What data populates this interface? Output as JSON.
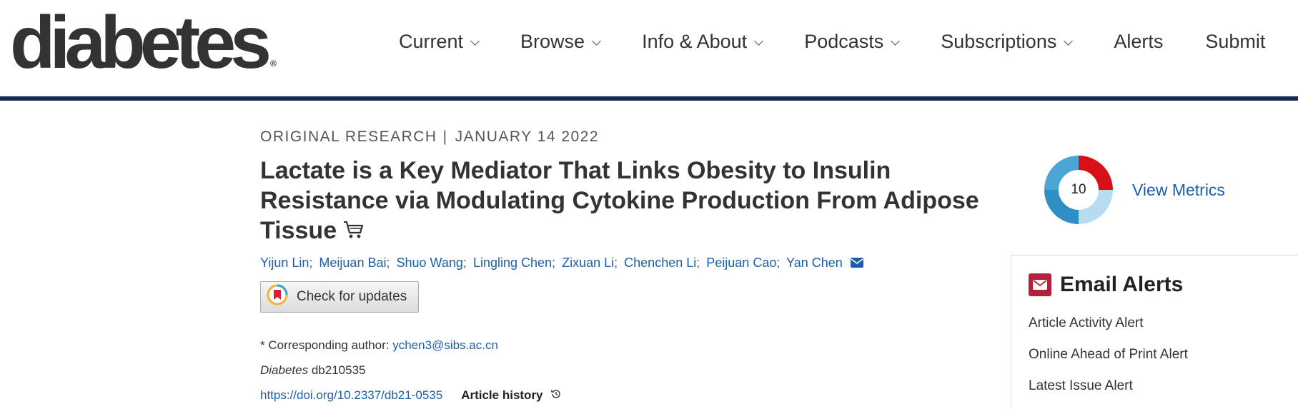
{
  "header": {
    "logo_text": "diabetes",
    "logo_mark": "®",
    "nav": [
      {
        "label": "Current",
        "dropdown": true
      },
      {
        "label": "Browse",
        "dropdown": true
      },
      {
        "label": "Info & About",
        "dropdown": true
      },
      {
        "label": "Podcasts",
        "dropdown": true
      },
      {
        "label": "Subscriptions",
        "dropdown": true
      },
      {
        "label": "Alerts",
        "dropdown": false
      },
      {
        "label": "Submit",
        "dropdown": false
      }
    ],
    "accent_color": "#0f2a52"
  },
  "article": {
    "type": "ORIGINAL RESEARCH",
    "separator": "|",
    "date": "JANUARY 14 2022",
    "title": "Lactate is a Key Mediator That Links Obesity to Insulin Resistance via Modulating Cytokine Production From Adipose Tissue",
    "authors": [
      "Yijun Lin",
      "Meijuan Bai",
      "Shuo Wang",
      "Lingling Chen",
      "Zixuan Li",
      "Chenchen Li",
      "Peijuan Cao",
      "Yan Chen"
    ],
    "check_updates_label": "Check for updates",
    "corresponding_label": "* Corresponding author:",
    "corresponding_email": "ychen3@sibs.ac.cn",
    "journal": "Diabetes",
    "article_id": "db210535",
    "doi": "https://doi.org/10.2337/db21-0535",
    "history_label": "Article history"
  },
  "metrics": {
    "score": "10",
    "link_label": "View Metrics"
  },
  "email_alerts": {
    "title": "Email Alerts",
    "items": [
      "Article Activity Alert",
      "Online Ahead of Print Alert",
      "Latest Issue Alert"
    ]
  },
  "colors": {
    "link": "#1b5fa8",
    "alert_icon": "#b3203a"
  }
}
